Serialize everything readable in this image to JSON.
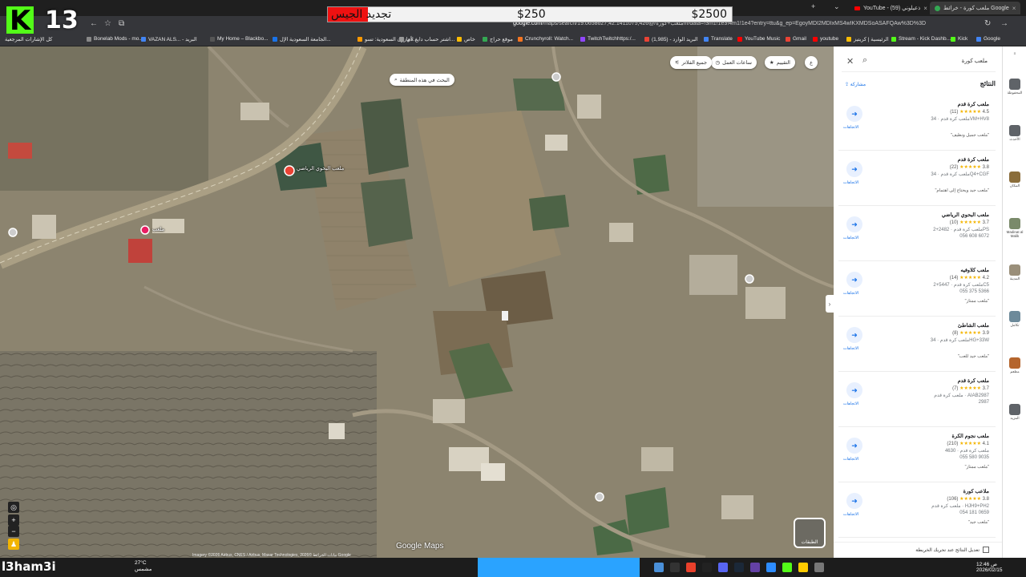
{
  "browser": {
    "tabs": [
      {
        "label": "YouTube - (59) ذعيلوني",
        "icon": "youtube-icon"
      },
      {
        "label": "ملعب كورة - خرائط Google",
        "icon": "maps-icon"
      }
    ],
    "url_domain": "google.com",
    "url_path": "/maps/search/ملعب+كورة/@19.0658627,42.1411075,426m/data=!3m1!1e3!4m1!1e4?entry=ttu&g_ep=EgoyMDI2MDIxMS4wIKXMDSoASAFQAw%3D%3D",
    "bookmarks": [
      {
        "label": "Bonelab Mods - mo...",
        "color": "#888"
      },
      {
        "label": "VAZAN ALS... - البريد",
        "color": "#4285f4"
      },
      {
        "label": "My Home – Blackbo...",
        "color": "#555"
      },
      {
        "label": "الجامعة السعودية الإل...",
        "color": "#1a73e8"
      },
      {
        "label": "أمازون السعودية: تسو...",
        "color": "#ff9900"
      },
      {
        "label": "اشتر حساب دايغ لاي...",
        "color": "#999"
      },
      {
        "label": "خاص",
        "color": "#fbbc04"
      },
      {
        "label": "موقع حراج",
        "color": "#34a853"
      },
      {
        "label": "Crunchyroll: Watch...",
        "color": "#f47521"
      },
      {
        "label": "TwitchTwitchhttps:/...",
        "color": "#9146ff"
      },
      {
        "label": "(1,985) - البريد الوارد",
        "color": "#ea4335"
      },
      {
        "label": "Translate",
        "color": "#4285f4"
      },
      {
        "label": "YouTube Music",
        "color": "#f00"
      },
      {
        "label": "Gmail",
        "color": "#ea4335"
      },
      {
        "label": "youtube",
        "color": "#f00"
      },
      {
        "label": "الرئيسية | كريتيز",
        "color": "#fbbc04"
      },
      {
        "label": "Stream - Kick Dashb...",
        "color": "#53fc18"
      },
      {
        "label": "Kick",
        "color": "#53fc18"
      },
      {
        "label": "Google",
        "color": "#4285f4"
      }
    ],
    "bookmarks_folder": "كل الإشارات المرجعية"
  },
  "overlay": {
    "logo": "K",
    "count": "13",
    "goal_title": "تجديد الجيس",
    "goal_current": "$250",
    "goal_max": "$2500",
    "goal_progress": 0.1
  },
  "map": {
    "chips": [
      {
        "label": "ع",
        "icon": "filter-icon"
      },
      {
        "label": "التقييم",
        "icon": "star-icon"
      },
      {
        "label": "ساعات العمل",
        "icon": "clock-icon"
      },
      {
        "label": "جميع الفلاتر",
        "icon": "sliders-icon"
      }
    ],
    "search_this_area": "البحث في هذه المنطقة",
    "pin_labels": [
      {
        "label": "ملعب البحوي الرياضي"
      },
      {
        "label": "ملعب"
      }
    ],
    "google_logo": "Google Maps",
    "attribution": "Imagery ©2026 Airbus, CNES / Airbus, Maxar Technologies, بيانات الخرائط ©2026 Google",
    "layers_label": "الطبقات"
  },
  "panel": {
    "query": "ملعب كورة",
    "results_title": "النتائج",
    "share_label": "مشاركة",
    "results": [
      {
        "name": "ملعب كرة قدم",
        "rating": "4.5",
        "count": "(11)",
        "meta": "ملعب كرة قدم · 34VM+HV8",
        "meta2": "",
        "review": "\"ملعب جميل ونظيف\""
      },
      {
        "name": "ملعب كرة قدم",
        "rating": "3.8",
        "count": "(22)",
        "meta": "ملعب كرة قدم · 34Q4+CGF",
        "meta2": "",
        "review": "\"ملعب جيد ويحتاج إلى اهتمام\""
      },
      {
        "name": "ملعب البحوي الرياضي",
        "rating": "3.7",
        "count": "(10)",
        "meta": "ملعب كرة قدم · 2482+2PS",
        "meta2": "056 608 6072",
        "review": ""
      },
      {
        "name": "ملعب كلاوفيه",
        "rating": "4.2",
        "count": "(14)",
        "meta": "ملعب كرة قدم · 5447+2C5",
        "meta2": "055 375 5366",
        "review": "\"ملعب ممتاز\""
      },
      {
        "name": "ملعب الشاطئ",
        "rating": "3.9",
        "count": "(8)",
        "meta": "ملعب كرة قدم · 34HG+33W",
        "meta2": "",
        "review": "\"ملعب جيد للعب\""
      },
      {
        "name": "ملعب كرة قدم",
        "rating": "3.7",
        "count": "(7)",
        "meta": "ملعب كرة قدم · AIAB2987",
        "meta2": "2987",
        "review": ""
      },
      {
        "name": "ملعب نجوم الكرة",
        "rating": "4.1",
        "count": "(210)",
        "meta": "ملعب كرة قدم · 4630",
        "meta2": "055 580 9035",
        "review": "\"ملعب ممتاز\""
      },
      {
        "name": "ملاعب كورة",
        "rating": "3.8",
        "count": "(106)",
        "meta": "ملعب كرة قدم · HJH9+PH2",
        "meta2": "054 181 0659",
        "review": "\"ملعب جيد\""
      }
    ],
    "directions_label": "الاتجاهات",
    "footer_checkbox": "تعديل النتائج عند تحريك الخريطة"
  },
  "rail": [
    {
      "label": "المحفوظة"
    },
    {
      "label": "الأحدث"
    },
    {
      "label": "المكان"
    },
    {
      "label": "Madinat al Malik"
    },
    {
      "label": "المدينة"
    },
    {
      "label": "تكامل"
    },
    {
      "label": "مطعم"
    },
    {
      "label": "المزيد"
    }
  ],
  "taskbar": {
    "logo": "l3ham3i",
    "temp": "27°C",
    "weather": "مشمس",
    "time": "12:46 ص",
    "date": "2026/02/15"
  }
}
